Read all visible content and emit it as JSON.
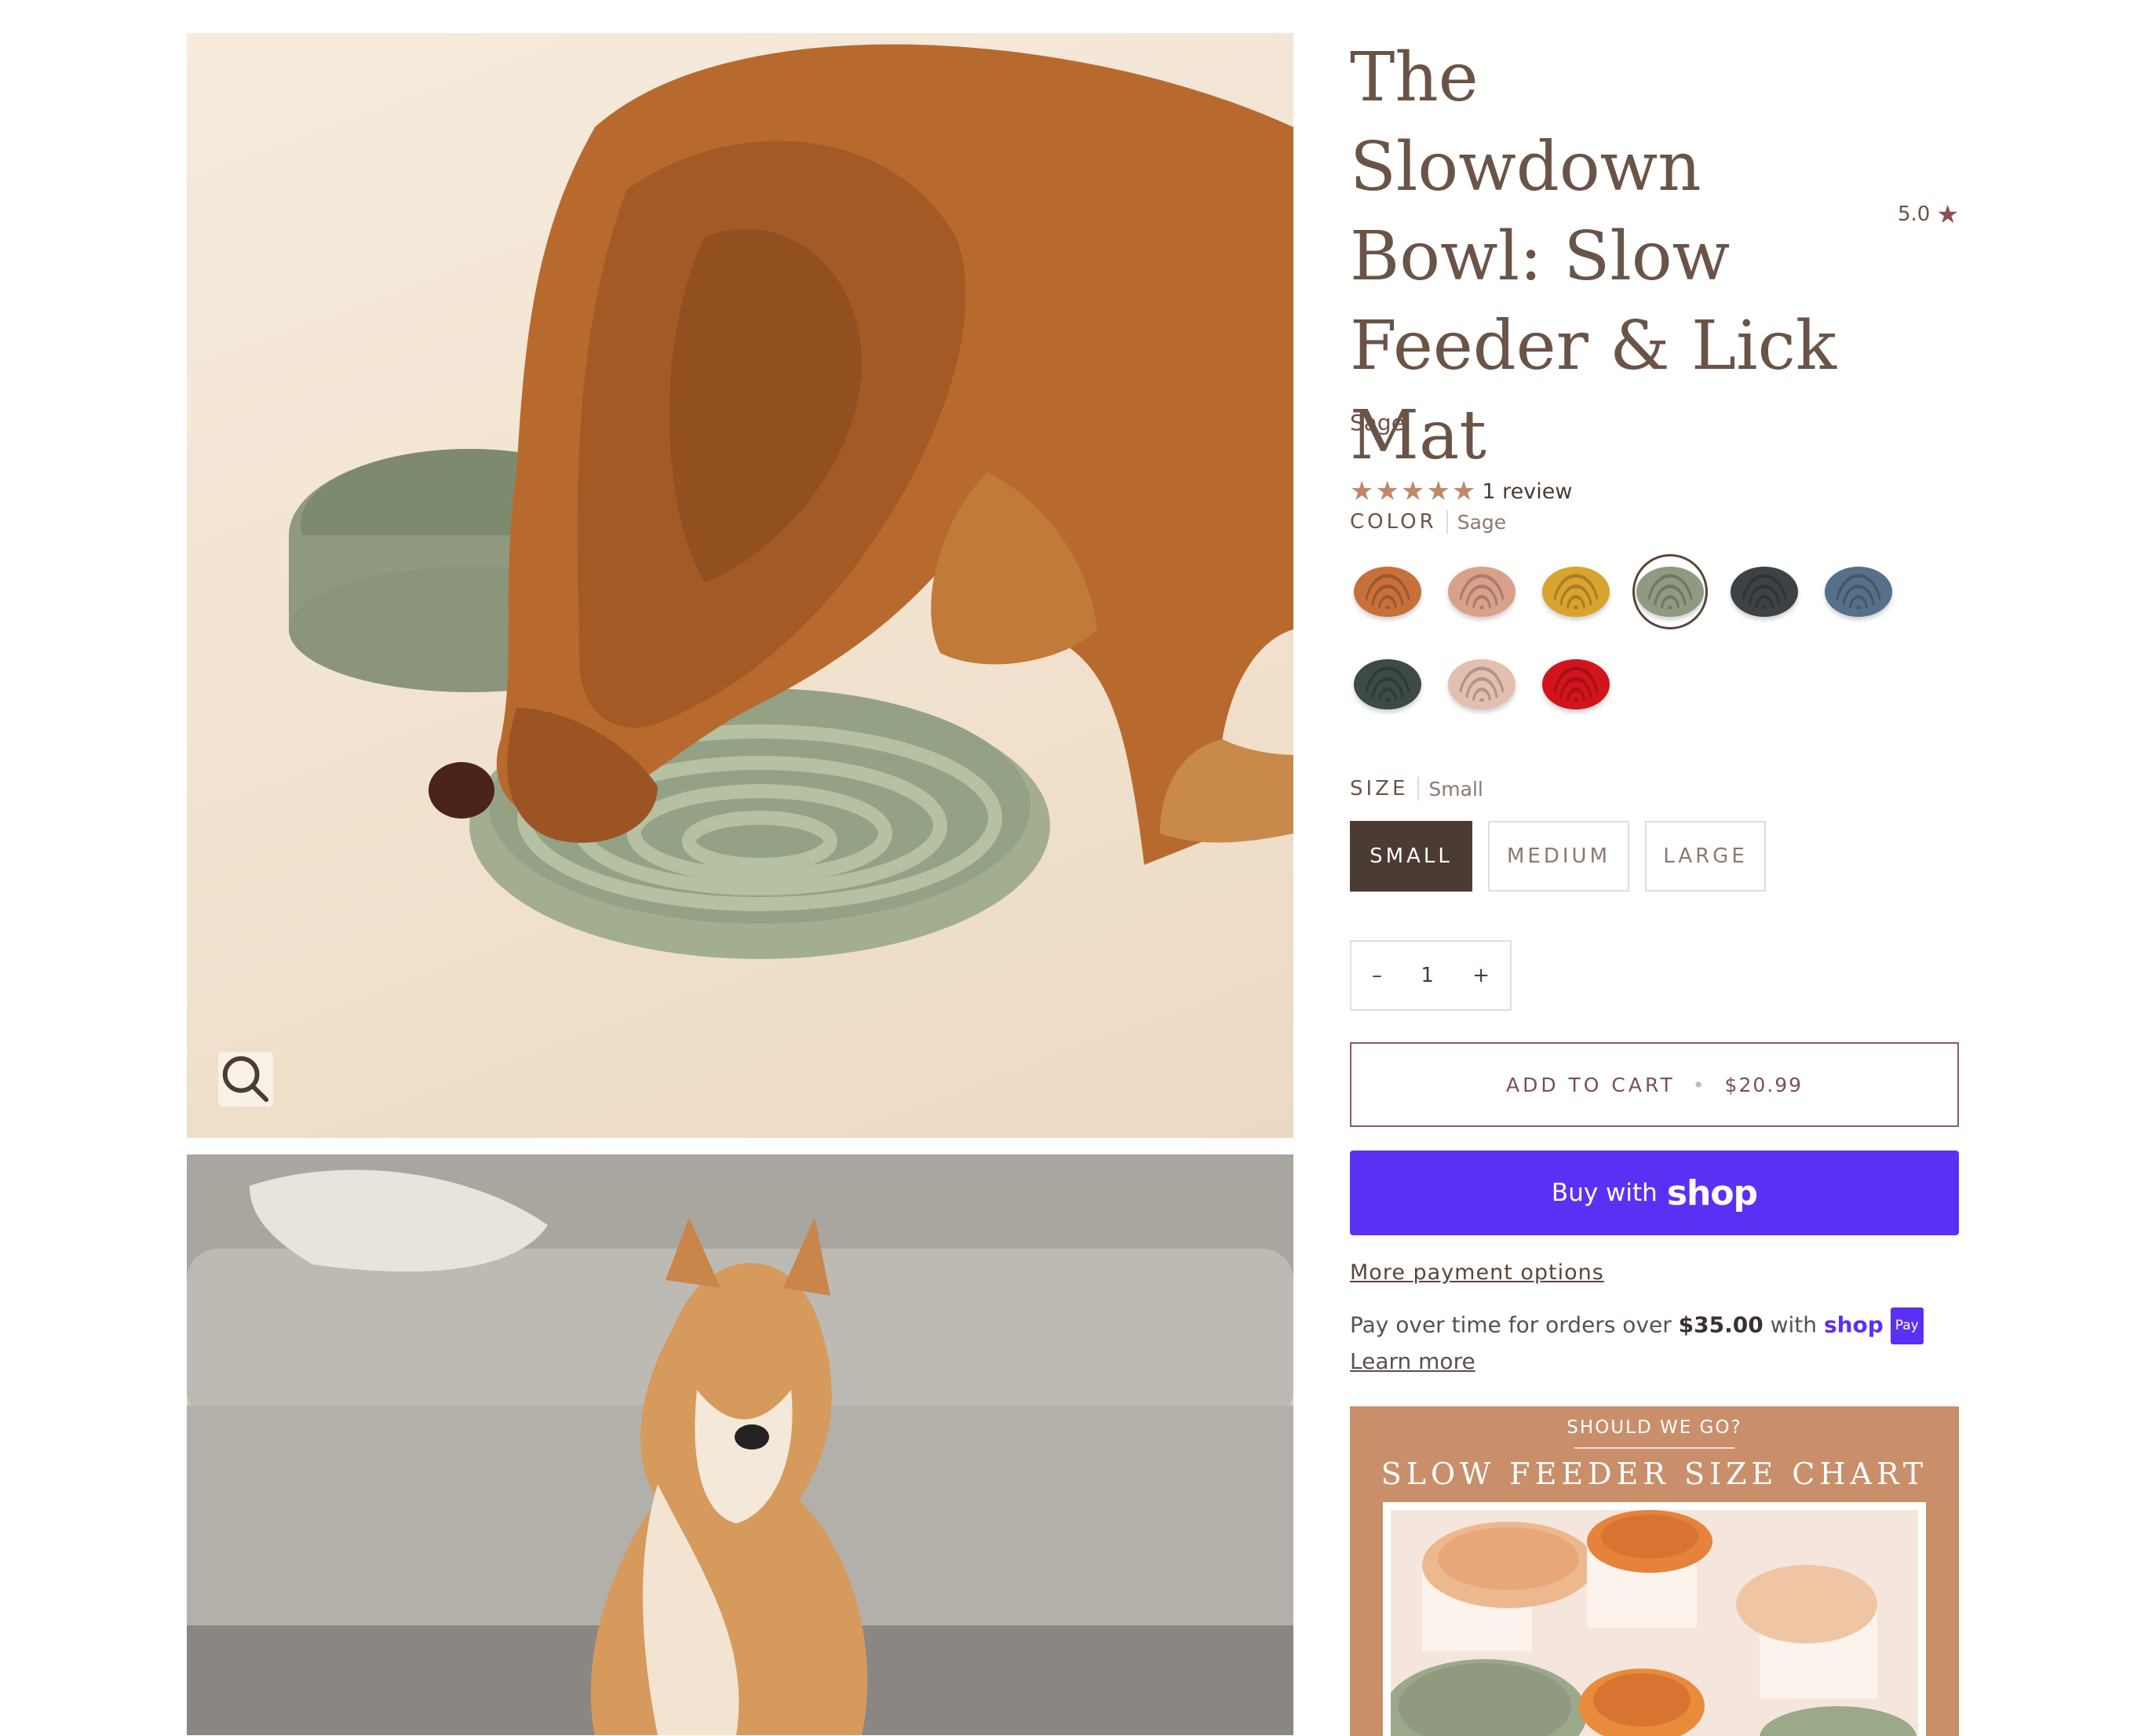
{
  "product": {
    "title": "The Slowdown Bowl: Slow Feeder & Lick Mat",
    "rating_value": "5.0",
    "variant_name": "Sage",
    "review_count_text": "1 review",
    "rating_stars": 5
  },
  "color_option": {
    "label": "COLOR",
    "selected": "Sage",
    "swatches": [
      {
        "name": "terracotta",
        "color": "#c8703a"
      },
      {
        "name": "blush",
        "color": "#d9a08a"
      },
      {
        "name": "mustard",
        "color": "#d8a32e"
      },
      {
        "name": "sage",
        "color": "#8f9a80"
      },
      {
        "name": "charcoal",
        "color": "#3c4246"
      },
      {
        "name": "slate-blue",
        "color": "#56708a"
      },
      {
        "name": "forest",
        "color": "#3d4a46"
      },
      {
        "name": "sand-pink",
        "color": "#e2bfae"
      },
      {
        "name": "red",
        "color": "#d2141d"
      }
    ]
  },
  "size_option": {
    "label": "SIZE",
    "selected": "Small",
    "buttons": [
      "SMALL",
      "MEDIUM",
      "LARGE"
    ]
  },
  "quantity": {
    "minus": "–",
    "value": "1",
    "plus": "+"
  },
  "add_to_cart": {
    "label": "ADD TO CART",
    "separator": "•",
    "price": "$20.99"
  },
  "shop_pay": {
    "prefix": "Buy with",
    "brand": "shop"
  },
  "more_payment_options": "More payment options",
  "installments": {
    "text_before": "Pay over time for orders over ",
    "amount": "$35.00",
    "text_after": " with ",
    "brand": "shop",
    "badge": "Pay",
    "learn_more": "Learn more"
  },
  "size_chart": {
    "kicker": "SHOULD WE GO?",
    "heading": "SLOW FEEDER SIZE CHART"
  },
  "icons": {
    "zoom": "search-icon",
    "rating": "star-icon"
  }
}
